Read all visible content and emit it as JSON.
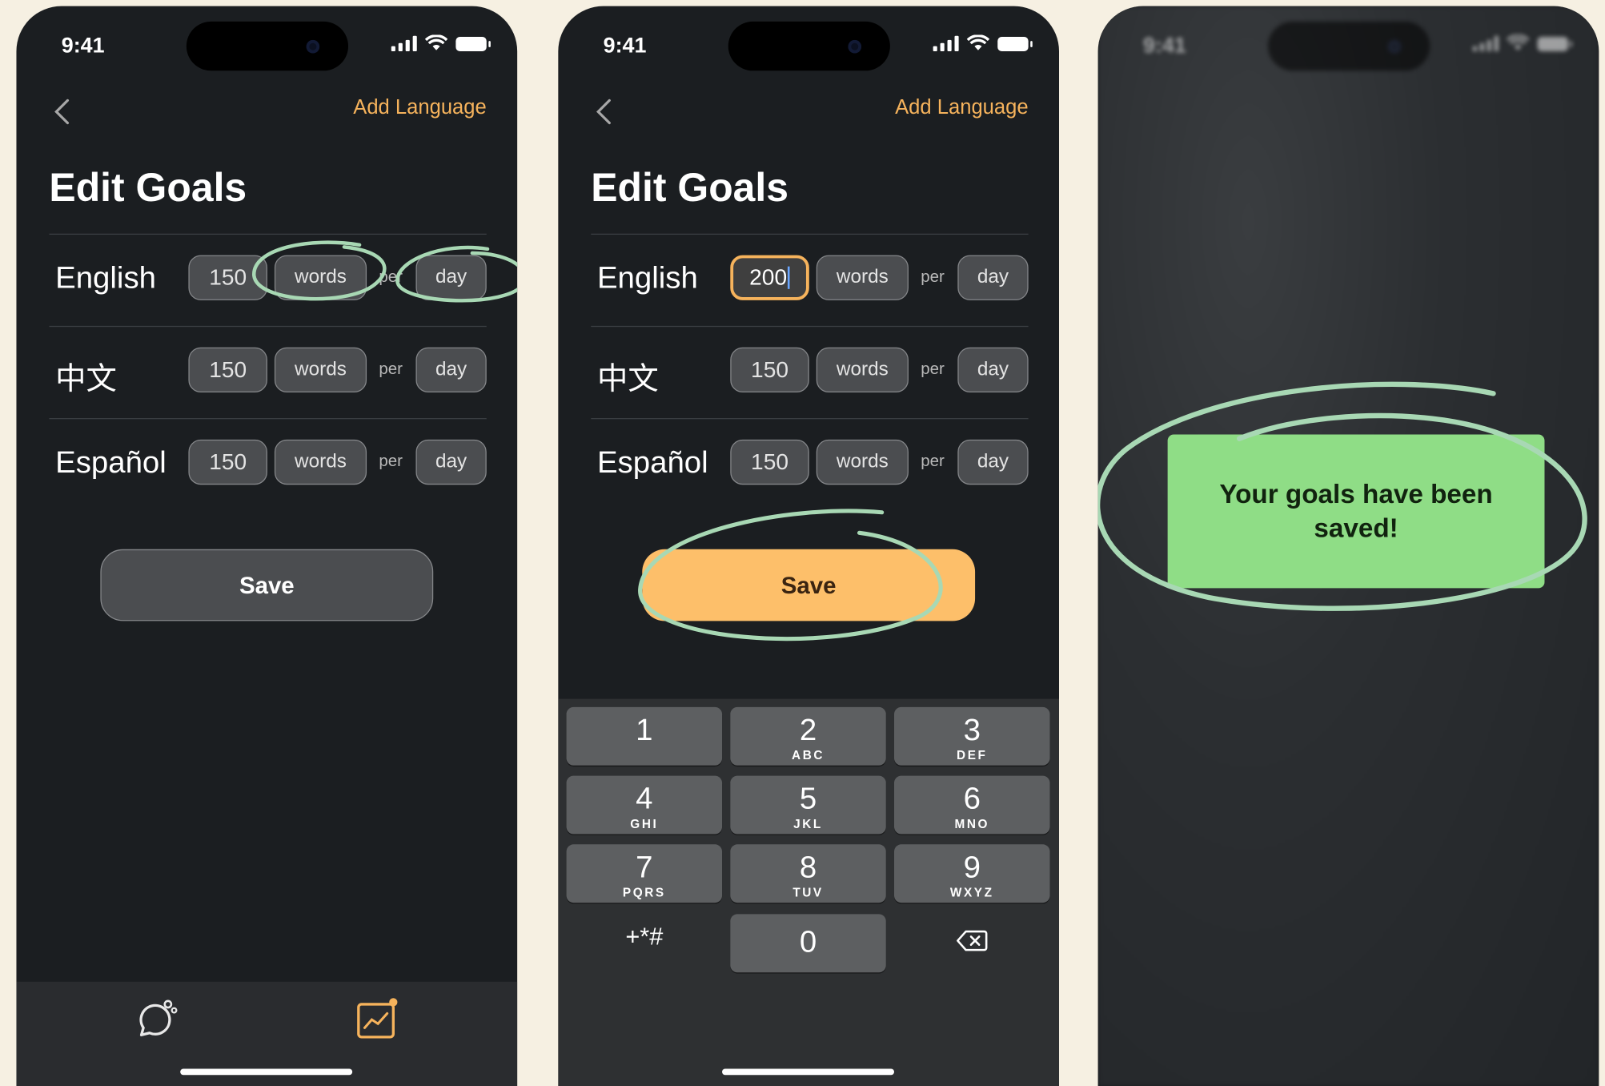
{
  "status": {
    "time": "9:41"
  },
  "nav": {
    "add_language": "Add Language"
  },
  "page": {
    "title": "Edit Goals"
  },
  "goals_initial": [
    {
      "language": "English",
      "amount": "150",
      "unit": "words",
      "per": "per",
      "period": "day"
    },
    {
      "language": "中文",
      "amount": "150",
      "unit": "words",
      "per": "per",
      "period": "day"
    },
    {
      "language": "Español",
      "amount": "150",
      "unit": "words",
      "per": "per",
      "period": "day"
    }
  ],
  "goals_editing": [
    {
      "language": "English",
      "amount": "200",
      "unit": "words",
      "per": "per",
      "period": "day"
    },
    {
      "language": "中文",
      "amount": "150",
      "unit": "words",
      "per": "per",
      "period": "day"
    },
    {
      "language": "Español",
      "amount": "150",
      "unit": "words",
      "per": "per",
      "period": "day"
    }
  ],
  "save_label": "Save",
  "keypad": [
    {
      "digit": "1",
      "letters": ""
    },
    {
      "digit": "2",
      "letters": "ABC"
    },
    {
      "digit": "3",
      "letters": "DEF"
    },
    {
      "digit": "4",
      "letters": "GHI"
    },
    {
      "digit": "5",
      "letters": "JKL"
    },
    {
      "digit": "6",
      "letters": "MNO"
    },
    {
      "digit": "7",
      "letters": "PQRS"
    },
    {
      "digit": "8",
      "letters": "TUV"
    },
    {
      "digit": "9",
      "letters": "WXYZ"
    },
    {
      "symbols": "+*#",
      "digit": "0",
      "delete_icon": "backspace-icon"
    }
  ],
  "tabs": [
    {
      "icon": "chat-bubble-icon"
    },
    {
      "icon": "progress-chart-icon"
    }
  ],
  "toast": {
    "message": "Your goals have been saved!"
  },
  "colors": {
    "accent": "#f6b35c",
    "save_active": "#fdbf6a",
    "toast_bg": "#8fdd86",
    "annotation": "#a8d8b4",
    "background": "#f6f0e2"
  }
}
